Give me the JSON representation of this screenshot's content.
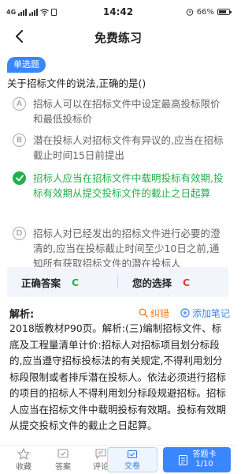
{
  "status": {
    "network": "4G",
    "time": "14:42",
    "battery": "66%"
  },
  "nav": {
    "title": "免费练习"
  },
  "question": {
    "type": "单选题",
    "text": "关于招标文件的说法,正确的是()",
    "options": [
      {
        "letter": "A",
        "text": "招标人可以在招标文件中设定最高投标限价和最低投标价",
        "correct": false
      },
      {
        "letter": "B",
        "text": "潜在投标人对招标文件有异议的,应当在招标截止时间15日前提出",
        "correct": false
      },
      {
        "letter": "C",
        "text": "招标人应当在招标文件中载明投标有效期,投标有效期从提交投标文件的截止之日起算",
        "correct": true
      },
      {
        "letter": "D",
        "text": "招标人对已经发出的招标文件进行必要的澄清的,应当在投标截止时间至少10日之前,通知所有获取招标文件的潜在投标人",
        "correct": false
      }
    ]
  },
  "answer": {
    "correct_label": "正确答案",
    "correct_value": "C",
    "mine_label": "您的选择",
    "mine_value": "C"
  },
  "analysis": {
    "title": "解析:",
    "error_link": "纠错",
    "note_link": "添加笔记",
    "body": "2018版教材P90页。解析:(三)编制招标文件、标底及工程量清单计价:招标人对招标项目划分标段的,应当遵守招标投标法的有关规定,不得利用划分标段限制或者排斥潜在投标人。依法必须进行招标的项目的招标人不得利用划分标段规避招标。招标人应当在招标文件中载明投标有效期。投标有效期从提交投标文件的截止之日起算。"
  },
  "bottom_bar": {
    "favorite": "收藏",
    "answer": "答案",
    "comment": "评论",
    "submit": "交卷",
    "card": "答题卡",
    "progress": "1/10"
  },
  "colors": {
    "accent": "#3a86ff",
    "correct": "#22b04a",
    "wrong": "#e53935",
    "orange": "#ef7d1a"
  }
}
